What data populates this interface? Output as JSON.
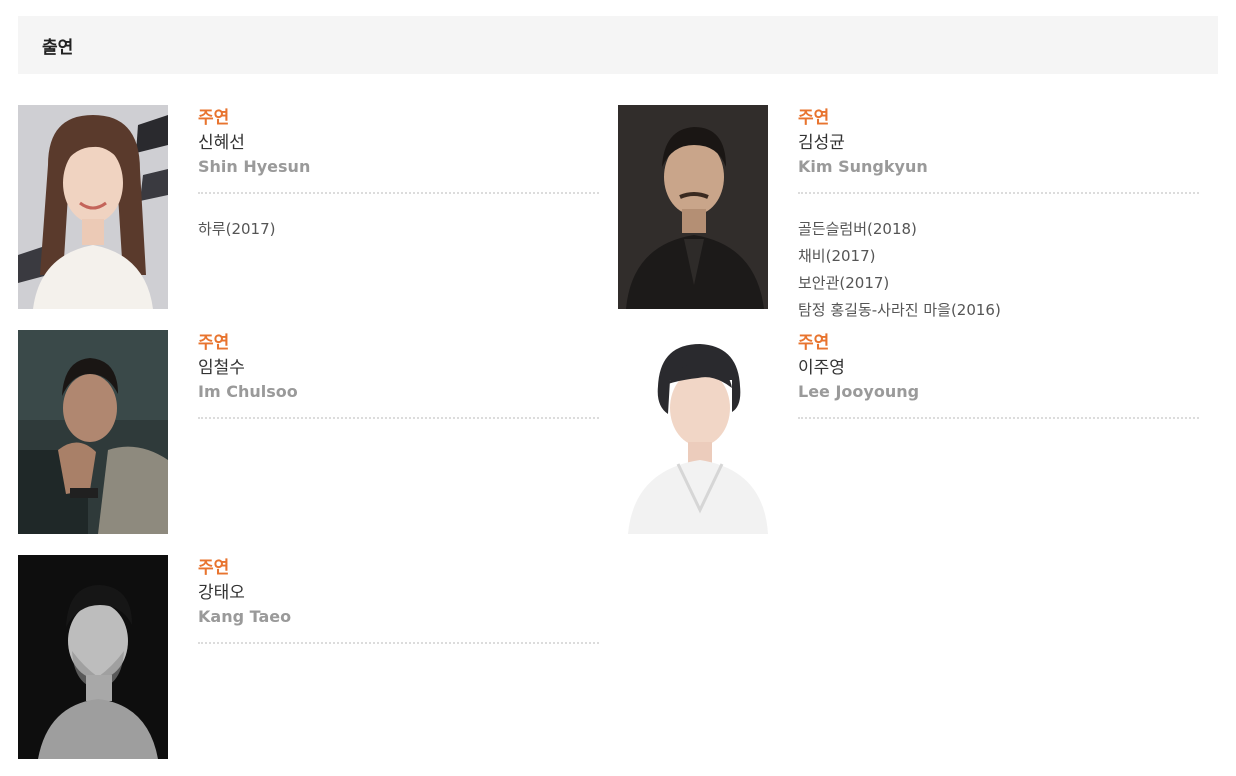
{
  "section": {
    "title": "출연"
  },
  "cast": [
    {
      "role": "주연",
      "name_ko": "신혜선",
      "name_en": "Shin Hyesun",
      "works": [
        "하루(2017)"
      ]
    },
    {
      "role": "주연",
      "name_ko": "김성균",
      "name_en": "Kim Sungkyun",
      "works": [
        "골든슬럼버(2018)",
        "채비(2017)",
        "보안관(2017)",
        "탐정 홍길동-사라진 마을(2016)"
      ]
    },
    {
      "role": "주연",
      "name_ko": "임철수",
      "name_en": "Im Chulsoo",
      "works": []
    },
    {
      "role": "주연",
      "name_ko": "이주영",
      "name_en": "Lee Jooyoung",
      "works": []
    },
    {
      "role": "주연",
      "name_ko": "강태오",
      "name_en": "Kang Taeo",
      "works": []
    }
  ],
  "colors": {
    "role_accent": "#e8742f",
    "header_bg": "#f5f5f5",
    "english_name": "#9a9a9a"
  }
}
